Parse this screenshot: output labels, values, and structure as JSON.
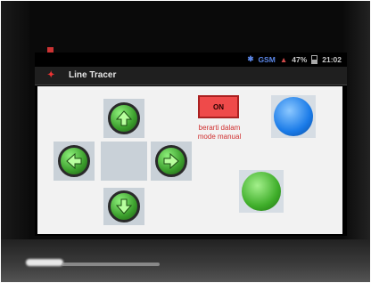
{
  "status_bar": {
    "network_label": "GSM",
    "battery_percent": "47%",
    "time": "21:02"
  },
  "app": {
    "title": "Line Tracer"
  },
  "controls": {
    "toggle_label": "ON",
    "mode_caption_line1": "berarti dalam",
    "mode_caption_line2": "mode manual"
  },
  "icons": {
    "up": "arrow-up-icon",
    "down": "arrow-down-icon",
    "left": "arrow-left-icon",
    "right": "arrow-right-icon"
  },
  "colors": {
    "arrow_green": "#3a9d2b",
    "on_red": "#ef4a4a",
    "blue_button": "#1a7be8",
    "green_button": "#3fae2a"
  }
}
